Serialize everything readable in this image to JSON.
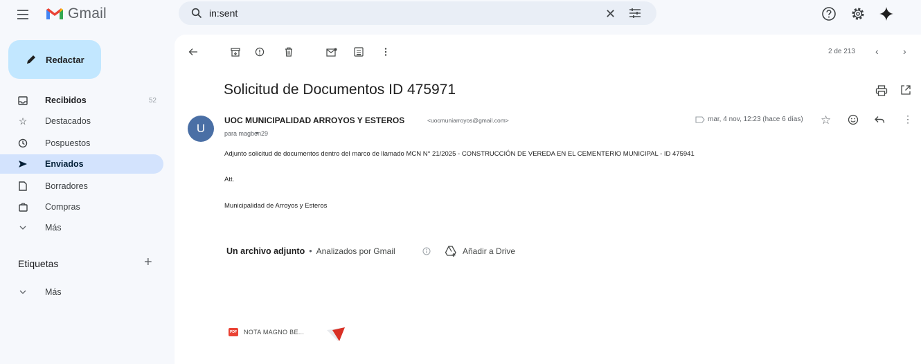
{
  "app": {
    "name": "Gmail"
  },
  "search": {
    "query": "in:sent"
  },
  "sidebar": {
    "compose_label": "Redactar",
    "items": [
      {
        "label": "Recibidos",
        "count": "52"
      },
      {
        "label": "Destacados"
      },
      {
        "label": "Pospuestos"
      },
      {
        "label": "Enviados"
      },
      {
        "label": "Borradores"
      },
      {
        "label": "Compras"
      },
      {
        "label": "Más"
      }
    ],
    "labels_heading": "Etiquetas",
    "labels_add": "+",
    "labels_more": "Más"
  },
  "toolbar": {
    "pager": "2 de 213"
  },
  "email": {
    "subject": "Solicitud de Documentos ID 475971",
    "avatar_letter": "U",
    "sender_name": "UOC MUNICIPALIDAD ARROYOS Y ESTEROS",
    "sender_email": "<uocmuniarroyos@gmail.com>",
    "recipient": "para magben29",
    "date": "mar, 4 nov, 12:23 (hace 6 días)",
    "body": [
      "Adjunto solicitud de documentos dentro del marco de llamado MCN N° 21/2025 - CONSTRUCCIÓN DE VEREDA EN EL CEMENTERIO MUNICIPAL - ID 475941",
      "Att.",
      "Municipalidad de Arroyos y Esteros"
    ]
  },
  "attachments": {
    "title": "Un archivo adjunto",
    "separator": "•",
    "scanned_label": "Analizados por Gmail",
    "drive_label": "Añadir a Drive",
    "files": [
      {
        "name": "NOTA MAGNO BE...",
        "type": "PDF"
      }
    ]
  },
  "colors": {
    "page_bg": "#f6f8fc",
    "search_bg": "#e9eef6",
    "compose_bg": "#c2e7ff",
    "active_nav_bg": "#d3e3fd",
    "avatar_bg": "#4a6fa5",
    "pdf_red": "#ea4335"
  }
}
